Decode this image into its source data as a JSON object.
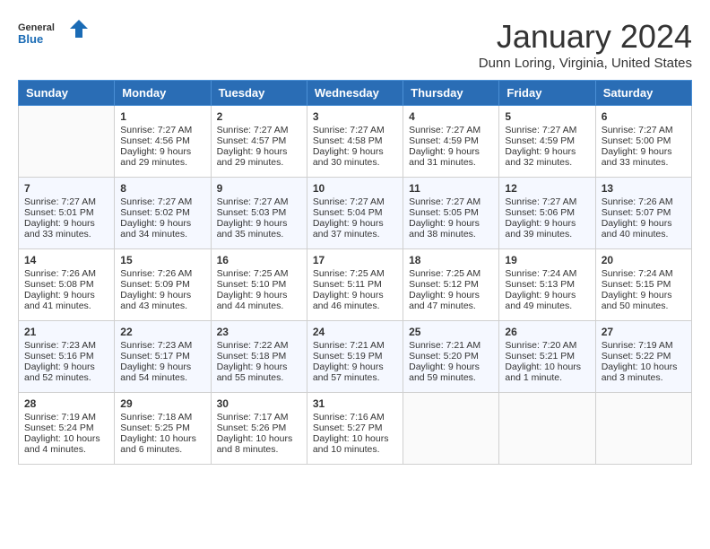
{
  "header": {
    "logo_line1": "General",
    "logo_line2": "Blue",
    "month": "January 2024",
    "location": "Dunn Loring, Virginia, United States"
  },
  "days_of_week": [
    "Sunday",
    "Monday",
    "Tuesday",
    "Wednesday",
    "Thursday",
    "Friday",
    "Saturday"
  ],
  "weeks": [
    [
      {
        "day": "",
        "sunrise": "",
        "sunset": "",
        "daylight": ""
      },
      {
        "day": "1",
        "sunrise": "Sunrise: 7:27 AM",
        "sunset": "Sunset: 4:56 PM",
        "daylight": "Daylight: 9 hours and 29 minutes."
      },
      {
        "day": "2",
        "sunrise": "Sunrise: 7:27 AM",
        "sunset": "Sunset: 4:57 PM",
        "daylight": "Daylight: 9 hours and 29 minutes."
      },
      {
        "day": "3",
        "sunrise": "Sunrise: 7:27 AM",
        "sunset": "Sunset: 4:58 PM",
        "daylight": "Daylight: 9 hours and 30 minutes."
      },
      {
        "day": "4",
        "sunrise": "Sunrise: 7:27 AM",
        "sunset": "Sunset: 4:59 PM",
        "daylight": "Daylight: 9 hours and 31 minutes."
      },
      {
        "day": "5",
        "sunrise": "Sunrise: 7:27 AM",
        "sunset": "Sunset: 4:59 PM",
        "daylight": "Daylight: 9 hours and 32 minutes."
      },
      {
        "day": "6",
        "sunrise": "Sunrise: 7:27 AM",
        "sunset": "Sunset: 5:00 PM",
        "daylight": "Daylight: 9 hours and 33 minutes."
      }
    ],
    [
      {
        "day": "7",
        "sunrise": "Sunrise: 7:27 AM",
        "sunset": "Sunset: 5:01 PM",
        "daylight": "Daylight: 9 hours and 33 minutes."
      },
      {
        "day": "8",
        "sunrise": "Sunrise: 7:27 AM",
        "sunset": "Sunset: 5:02 PM",
        "daylight": "Daylight: 9 hours and 34 minutes."
      },
      {
        "day": "9",
        "sunrise": "Sunrise: 7:27 AM",
        "sunset": "Sunset: 5:03 PM",
        "daylight": "Daylight: 9 hours and 35 minutes."
      },
      {
        "day": "10",
        "sunrise": "Sunrise: 7:27 AM",
        "sunset": "Sunset: 5:04 PM",
        "daylight": "Daylight: 9 hours and 37 minutes."
      },
      {
        "day": "11",
        "sunrise": "Sunrise: 7:27 AM",
        "sunset": "Sunset: 5:05 PM",
        "daylight": "Daylight: 9 hours and 38 minutes."
      },
      {
        "day": "12",
        "sunrise": "Sunrise: 7:27 AM",
        "sunset": "Sunset: 5:06 PM",
        "daylight": "Daylight: 9 hours and 39 minutes."
      },
      {
        "day": "13",
        "sunrise": "Sunrise: 7:26 AM",
        "sunset": "Sunset: 5:07 PM",
        "daylight": "Daylight: 9 hours and 40 minutes."
      }
    ],
    [
      {
        "day": "14",
        "sunrise": "Sunrise: 7:26 AM",
        "sunset": "Sunset: 5:08 PM",
        "daylight": "Daylight: 9 hours and 41 minutes."
      },
      {
        "day": "15",
        "sunrise": "Sunrise: 7:26 AM",
        "sunset": "Sunset: 5:09 PM",
        "daylight": "Daylight: 9 hours and 43 minutes."
      },
      {
        "day": "16",
        "sunrise": "Sunrise: 7:25 AM",
        "sunset": "Sunset: 5:10 PM",
        "daylight": "Daylight: 9 hours and 44 minutes."
      },
      {
        "day": "17",
        "sunrise": "Sunrise: 7:25 AM",
        "sunset": "Sunset: 5:11 PM",
        "daylight": "Daylight: 9 hours and 46 minutes."
      },
      {
        "day": "18",
        "sunrise": "Sunrise: 7:25 AM",
        "sunset": "Sunset: 5:12 PM",
        "daylight": "Daylight: 9 hours and 47 minutes."
      },
      {
        "day": "19",
        "sunrise": "Sunrise: 7:24 AM",
        "sunset": "Sunset: 5:13 PM",
        "daylight": "Daylight: 9 hours and 49 minutes."
      },
      {
        "day": "20",
        "sunrise": "Sunrise: 7:24 AM",
        "sunset": "Sunset: 5:15 PM",
        "daylight": "Daylight: 9 hours and 50 minutes."
      }
    ],
    [
      {
        "day": "21",
        "sunrise": "Sunrise: 7:23 AM",
        "sunset": "Sunset: 5:16 PM",
        "daylight": "Daylight: 9 hours and 52 minutes."
      },
      {
        "day": "22",
        "sunrise": "Sunrise: 7:23 AM",
        "sunset": "Sunset: 5:17 PM",
        "daylight": "Daylight: 9 hours and 54 minutes."
      },
      {
        "day": "23",
        "sunrise": "Sunrise: 7:22 AM",
        "sunset": "Sunset: 5:18 PM",
        "daylight": "Daylight: 9 hours and 55 minutes."
      },
      {
        "day": "24",
        "sunrise": "Sunrise: 7:21 AM",
        "sunset": "Sunset: 5:19 PM",
        "daylight": "Daylight: 9 hours and 57 minutes."
      },
      {
        "day": "25",
        "sunrise": "Sunrise: 7:21 AM",
        "sunset": "Sunset: 5:20 PM",
        "daylight": "Daylight: 9 hours and 59 minutes."
      },
      {
        "day": "26",
        "sunrise": "Sunrise: 7:20 AM",
        "sunset": "Sunset: 5:21 PM",
        "daylight": "Daylight: 10 hours and 1 minute."
      },
      {
        "day": "27",
        "sunrise": "Sunrise: 7:19 AM",
        "sunset": "Sunset: 5:22 PM",
        "daylight": "Daylight: 10 hours and 3 minutes."
      }
    ],
    [
      {
        "day": "28",
        "sunrise": "Sunrise: 7:19 AM",
        "sunset": "Sunset: 5:24 PM",
        "daylight": "Daylight: 10 hours and 4 minutes."
      },
      {
        "day": "29",
        "sunrise": "Sunrise: 7:18 AM",
        "sunset": "Sunset: 5:25 PM",
        "daylight": "Daylight: 10 hours and 6 minutes."
      },
      {
        "day": "30",
        "sunrise": "Sunrise: 7:17 AM",
        "sunset": "Sunset: 5:26 PM",
        "daylight": "Daylight: 10 hours and 8 minutes."
      },
      {
        "day": "31",
        "sunrise": "Sunrise: 7:16 AM",
        "sunset": "Sunset: 5:27 PM",
        "daylight": "Daylight: 10 hours and 10 minutes."
      },
      {
        "day": "",
        "sunrise": "",
        "sunset": "",
        "daylight": ""
      },
      {
        "day": "",
        "sunrise": "",
        "sunset": "",
        "daylight": ""
      },
      {
        "day": "",
        "sunrise": "",
        "sunset": "",
        "daylight": ""
      }
    ]
  ]
}
